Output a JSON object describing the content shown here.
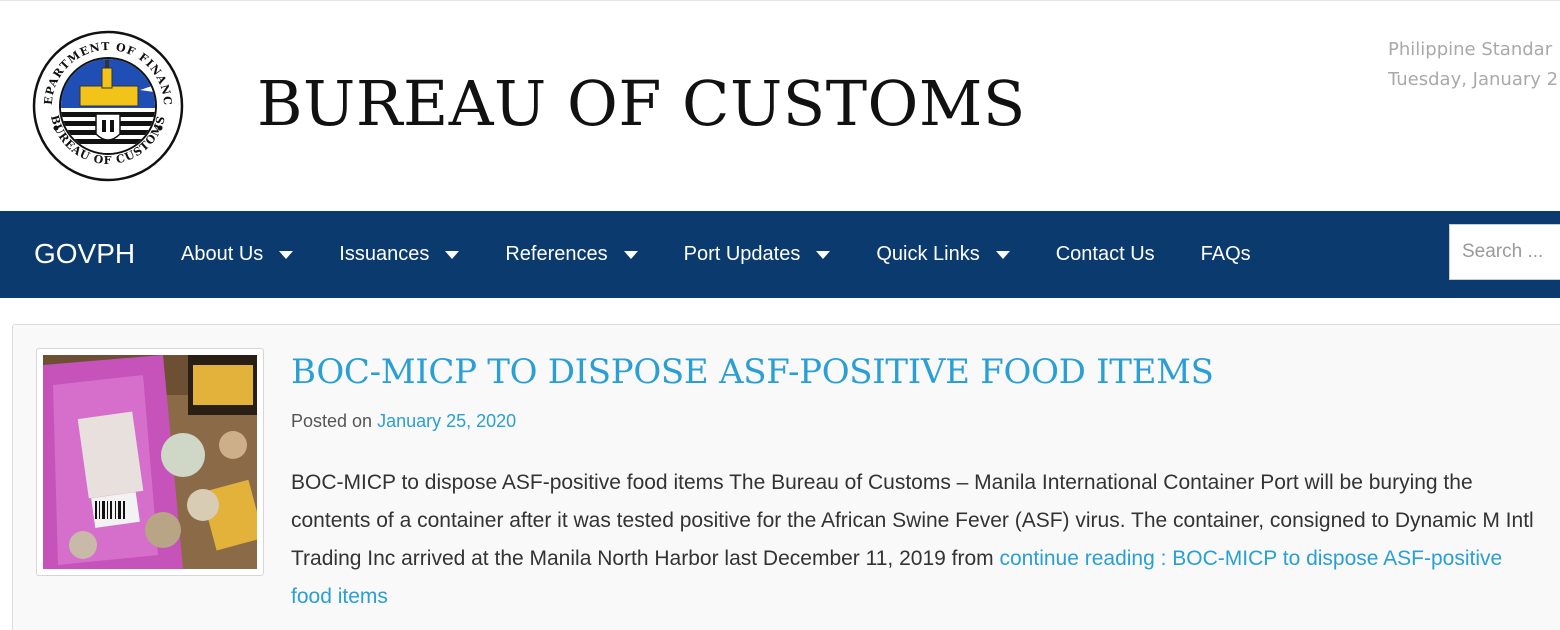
{
  "header": {
    "logo_ring_top": "DEPARTMENT OF FINANCE",
    "logo_ring_bottom": "BUREAU OF CUSTOMS",
    "site_title": "BUREAU OF CUSTOMS",
    "pst_line1": "Philippine Standar",
    "pst_line2": "Tuesday, January 2"
  },
  "nav": {
    "brand": "GOVPH",
    "items": [
      {
        "label": "About Us",
        "dropdown": true
      },
      {
        "label": "Issuances",
        "dropdown": true
      },
      {
        "label": "References",
        "dropdown": true
      },
      {
        "label": "Port Updates",
        "dropdown": true
      },
      {
        "label": "Quick Links",
        "dropdown": true
      },
      {
        "label": "Contact Us",
        "dropdown": false
      },
      {
        "label": "FAQs",
        "dropdown": false
      }
    ],
    "search_placeholder": "Search ..."
  },
  "post": {
    "title": "BOC-MICP TO DISPOSE ASF-POSITIVE FOOD ITEMS",
    "posted_on_label": "Posted on",
    "date": "January 25, 2020",
    "excerpt": "BOC-MICP to dispose ASF-positive food items The Bureau of Customs – Manila International Container Port will be burying the contents of a container after it was tested positive for the African Swine Fever (ASF) virus. The container, consigned to Dynamic M Intl Trading Inc arrived at the Manila North Harbor last December 11, 2019 from",
    "continue_link": "continue reading : BOC-MICP to dispose ASF-positive food items"
  },
  "colors": {
    "nav_bg": "#0b3a6e",
    "link": "#2a9fd6"
  }
}
